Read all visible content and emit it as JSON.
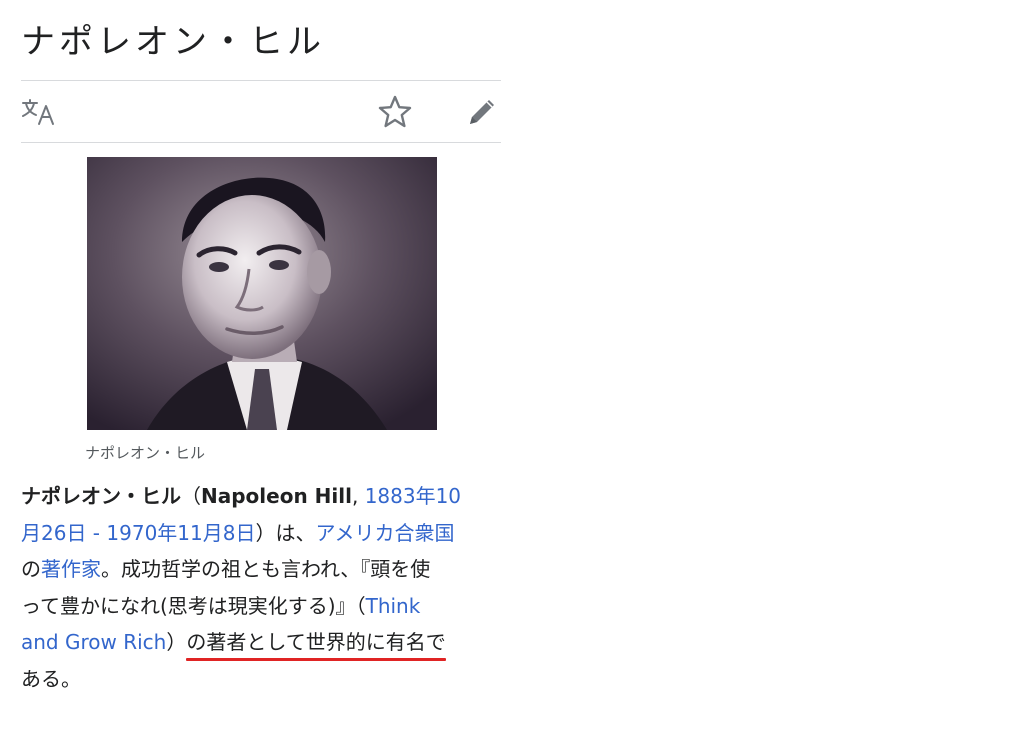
{
  "article": {
    "title": "ナポレオン・ヒル"
  },
  "toolbar": {
    "language_icon": "translate-icon",
    "watch_icon": "star-icon",
    "edit_icon": "pencil-icon"
  },
  "figure": {
    "caption": "ナポレオン・ヒル"
  },
  "intro": {
    "l1_name": "ナポレオン・ヒル",
    "l1_paren_open": "（",
    "l1_latin": "Napoleon Hill",
    "l1_comma": ", ",
    "l1_birth_link": "1883年10",
    "l2_birth_link": "月26日",
    "l2_dash": " - ",
    "l2_death_link": "1970年11月8日",
    "l2_paren_close_wa": "）は、",
    "l2_country_link": "アメリカ合衆国",
    "l3_no": "の",
    "l3_author_link": "著作家",
    "l3_text": "。成功哲学の祖とも言われ、『頭を使",
    "l4_text": "って豊かになれ(思考は現実化する)』（",
    "l4_book_link": "Think",
    "l5_book_link": "and Grow Rich",
    "l5_text": "）の著者として世界的に有名で",
    "l6_text": "ある。"
  },
  "colors": {
    "link": "#3366cc",
    "text": "#202122",
    "highlight_underline": "#e02424"
  }
}
